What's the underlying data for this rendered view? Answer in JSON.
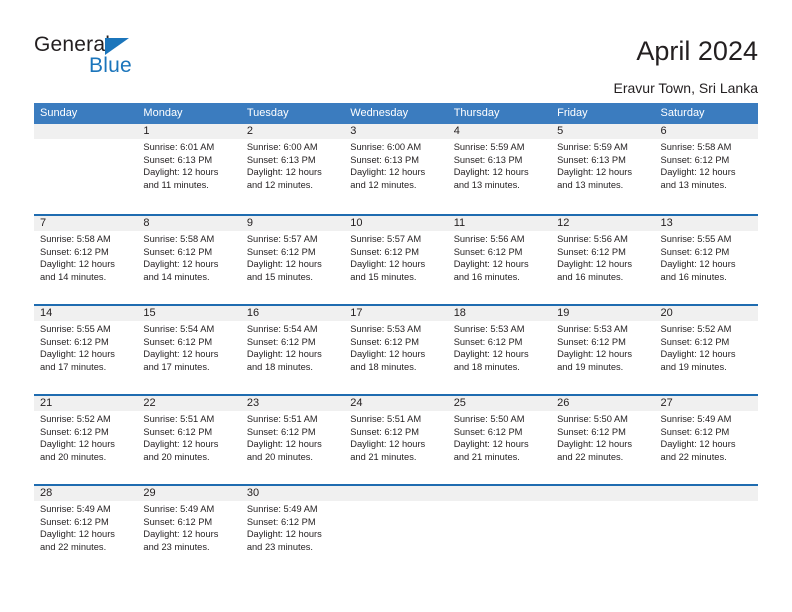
{
  "brand": {
    "name_part1": "General",
    "name_part2": "Blue",
    "triangle_icon": "triangle-icon",
    "accent_color": "#1b75bb"
  },
  "header": {
    "title": "April 2024",
    "subtitle": "Eravur Town, Sri Lanka"
  },
  "colors": {
    "header_blue": "#3b7cbf",
    "separator_blue": "#1f6cb0",
    "daynum_band": "#f0f0f0",
    "text": "#231f20"
  },
  "calendar": {
    "weekday_headers": [
      "Sunday",
      "Monday",
      "Tuesday",
      "Wednesday",
      "Thursday",
      "Friday",
      "Saturday"
    ],
    "weeks": [
      [
        {
          "day": "",
          "lines": []
        },
        {
          "day": "1",
          "lines": [
            "Sunrise: 6:01 AM",
            "Sunset: 6:13 PM",
            "Daylight: 12 hours",
            "and 11 minutes."
          ]
        },
        {
          "day": "2",
          "lines": [
            "Sunrise: 6:00 AM",
            "Sunset: 6:13 PM",
            "Daylight: 12 hours",
            "and 12 minutes."
          ]
        },
        {
          "day": "3",
          "lines": [
            "Sunrise: 6:00 AM",
            "Sunset: 6:13 PM",
            "Daylight: 12 hours",
            "and 12 minutes."
          ]
        },
        {
          "day": "4",
          "lines": [
            "Sunrise: 5:59 AM",
            "Sunset: 6:13 PM",
            "Daylight: 12 hours",
            "and 13 minutes."
          ]
        },
        {
          "day": "5",
          "lines": [
            "Sunrise: 5:59 AM",
            "Sunset: 6:13 PM",
            "Daylight: 12 hours",
            "and 13 minutes."
          ]
        },
        {
          "day": "6",
          "lines": [
            "Sunrise: 5:58 AM",
            "Sunset: 6:12 PM",
            "Daylight: 12 hours",
            "and 13 minutes."
          ]
        }
      ],
      [
        {
          "day": "7",
          "lines": [
            "Sunrise: 5:58 AM",
            "Sunset: 6:12 PM",
            "Daylight: 12 hours",
            "and 14 minutes."
          ]
        },
        {
          "day": "8",
          "lines": [
            "Sunrise: 5:58 AM",
            "Sunset: 6:12 PM",
            "Daylight: 12 hours",
            "and 14 minutes."
          ]
        },
        {
          "day": "9",
          "lines": [
            "Sunrise: 5:57 AM",
            "Sunset: 6:12 PM",
            "Daylight: 12 hours",
            "and 15 minutes."
          ]
        },
        {
          "day": "10",
          "lines": [
            "Sunrise: 5:57 AM",
            "Sunset: 6:12 PM",
            "Daylight: 12 hours",
            "and 15 minutes."
          ]
        },
        {
          "day": "11",
          "lines": [
            "Sunrise: 5:56 AM",
            "Sunset: 6:12 PM",
            "Daylight: 12 hours",
            "and 16 minutes."
          ]
        },
        {
          "day": "12",
          "lines": [
            "Sunrise: 5:56 AM",
            "Sunset: 6:12 PM",
            "Daylight: 12 hours",
            "and 16 minutes."
          ]
        },
        {
          "day": "13",
          "lines": [
            "Sunrise: 5:55 AM",
            "Sunset: 6:12 PM",
            "Daylight: 12 hours",
            "and 16 minutes."
          ]
        }
      ],
      [
        {
          "day": "14",
          "lines": [
            "Sunrise: 5:55 AM",
            "Sunset: 6:12 PM",
            "Daylight: 12 hours",
            "and 17 minutes."
          ]
        },
        {
          "day": "15",
          "lines": [
            "Sunrise: 5:54 AM",
            "Sunset: 6:12 PM",
            "Daylight: 12 hours",
            "and 17 minutes."
          ]
        },
        {
          "day": "16",
          "lines": [
            "Sunrise: 5:54 AM",
            "Sunset: 6:12 PM",
            "Daylight: 12 hours",
            "and 18 minutes."
          ]
        },
        {
          "day": "17",
          "lines": [
            "Sunrise: 5:53 AM",
            "Sunset: 6:12 PM",
            "Daylight: 12 hours",
            "and 18 minutes."
          ]
        },
        {
          "day": "18",
          "lines": [
            "Sunrise: 5:53 AM",
            "Sunset: 6:12 PM",
            "Daylight: 12 hours",
            "and 18 minutes."
          ]
        },
        {
          "day": "19",
          "lines": [
            "Sunrise: 5:53 AM",
            "Sunset: 6:12 PM",
            "Daylight: 12 hours",
            "and 19 minutes."
          ]
        },
        {
          "day": "20",
          "lines": [
            "Sunrise: 5:52 AM",
            "Sunset: 6:12 PM",
            "Daylight: 12 hours",
            "and 19 minutes."
          ]
        }
      ],
      [
        {
          "day": "21",
          "lines": [
            "Sunrise: 5:52 AM",
            "Sunset: 6:12 PM",
            "Daylight: 12 hours",
            "and 20 minutes."
          ]
        },
        {
          "day": "22",
          "lines": [
            "Sunrise: 5:51 AM",
            "Sunset: 6:12 PM",
            "Daylight: 12 hours",
            "and 20 minutes."
          ]
        },
        {
          "day": "23",
          "lines": [
            "Sunrise: 5:51 AM",
            "Sunset: 6:12 PM",
            "Daylight: 12 hours",
            "and 20 minutes."
          ]
        },
        {
          "day": "24",
          "lines": [
            "Sunrise: 5:51 AM",
            "Sunset: 6:12 PM",
            "Daylight: 12 hours",
            "and 21 minutes."
          ]
        },
        {
          "day": "25",
          "lines": [
            "Sunrise: 5:50 AM",
            "Sunset: 6:12 PM",
            "Daylight: 12 hours",
            "and 21 minutes."
          ]
        },
        {
          "day": "26",
          "lines": [
            "Sunrise: 5:50 AM",
            "Sunset: 6:12 PM",
            "Daylight: 12 hours",
            "and 22 minutes."
          ]
        },
        {
          "day": "27",
          "lines": [
            "Sunrise: 5:49 AM",
            "Sunset: 6:12 PM",
            "Daylight: 12 hours",
            "and 22 minutes."
          ]
        }
      ],
      [
        {
          "day": "28",
          "lines": [
            "Sunrise: 5:49 AM",
            "Sunset: 6:12 PM",
            "Daylight: 12 hours",
            "and 22 minutes."
          ]
        },
        {
          "day": "29",
          "lines": [
            "Sunrise: 5:49 AM",
            "Sunset: 6:12 PM",
            "Daylight: 12 hours",
            "and 23 minutes."
          ]
        },
        {
          "day": "30",
          "lines": [
            "Sunrise: 5:49 AM",
            "Sunset: 6:12 PM",
            "Daylight: 12 hours",
            "and 23 minutes."
          ]
        },
        {
          "day": "",
          "lines": []
        },
        {
          "day": "",
          "lines": []
        },
        {
          "day": "",
          "lines": []
        },
        {
          "day": "",
          "lines": []
        }
      ]
    ]
  }
}
